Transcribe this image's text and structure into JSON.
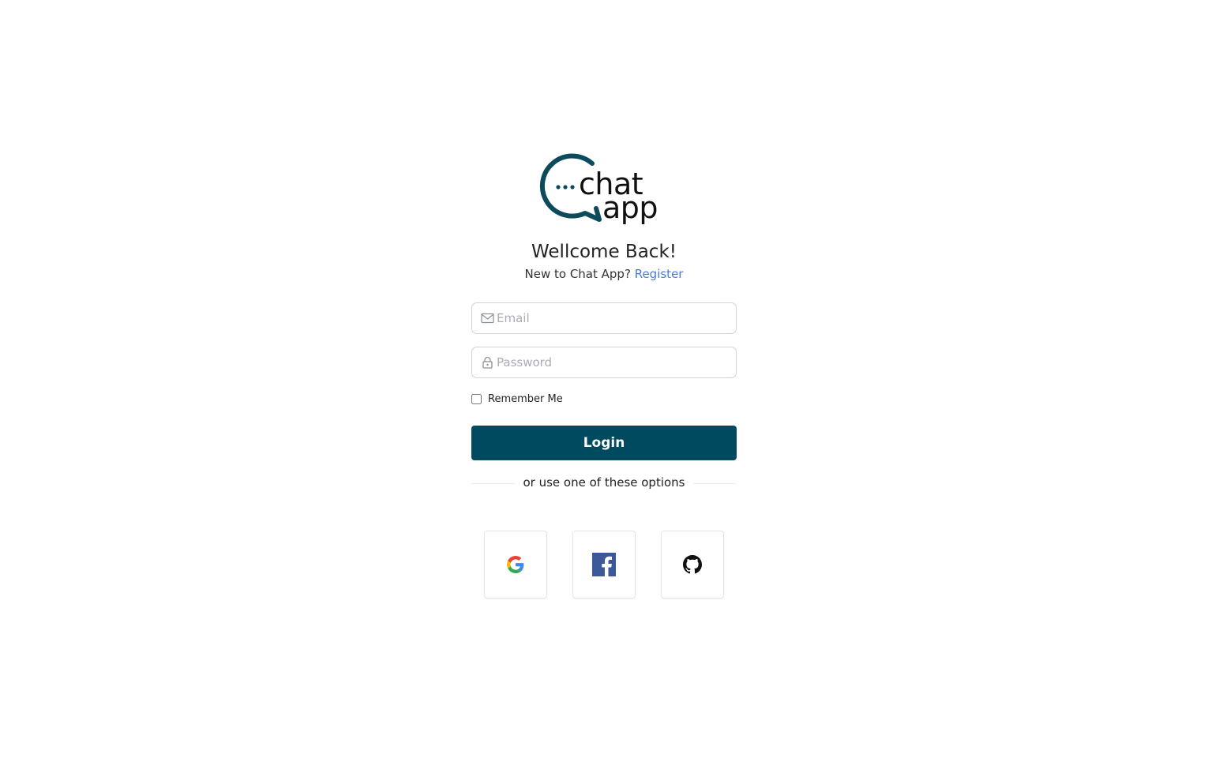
{
  "logo": {
    "line1": "chat",
    "line2": "app",
    "brand_color": "#0b4b5c"
  },
  "header": {
    "title": "Wellcome Back!",
    "subtitle_prefix": "New to Chat App?",
    "register_link": "Register"
  },
  "form": {
    "email_placeholder": "Email",
    "email_icon": "envelope-icon",
    "password_placeholder": "Password",
    "password_icon": "lock-icon",
    "remember_label": "Remember Me",
    "remember_checked": false,
    "login_label": "Login"
  },
  "alt_login": {
    "divider_text": "or use one of these options",
    "providers": [
      {
        "name": "google",
        "icon": "google-icon"
      },
      {
        "name": "facebook",
        "icon": "facebook-icon"
      },
      {
        "name": "github",
        "icon": "github-icon"
      }
    ]
  },
  "colors": {
    "primary": "#004a5f",
    "link": "#4a7bd6"
  }
}
